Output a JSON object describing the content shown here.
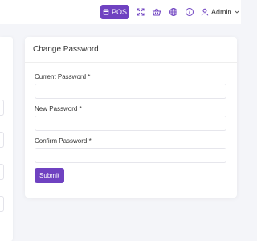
{
  "topbar": {
    "pos_label": "POS",
    "icons": [
      "store-icon",
      "fullscreen-icon",
      "basket-icon",
      "language-globe-icon",
      "info-icon",
      "user-icon",
      "chevron-down-icon"
    ],
    "user_name": "Admin",
    "accent_color": "#6f42c1"
  },
  "form": {
    "title": "Change Password",
    "current_password_label": "Current Password *",
    "current_password_value": "",
    "new_password_label": "New Password *",
    "new_password_value": "",
    "confirm_password_label": "Confirm Password *",
    "confirm_password_value": "",
    "submit_label": "Submit"
  }
}
